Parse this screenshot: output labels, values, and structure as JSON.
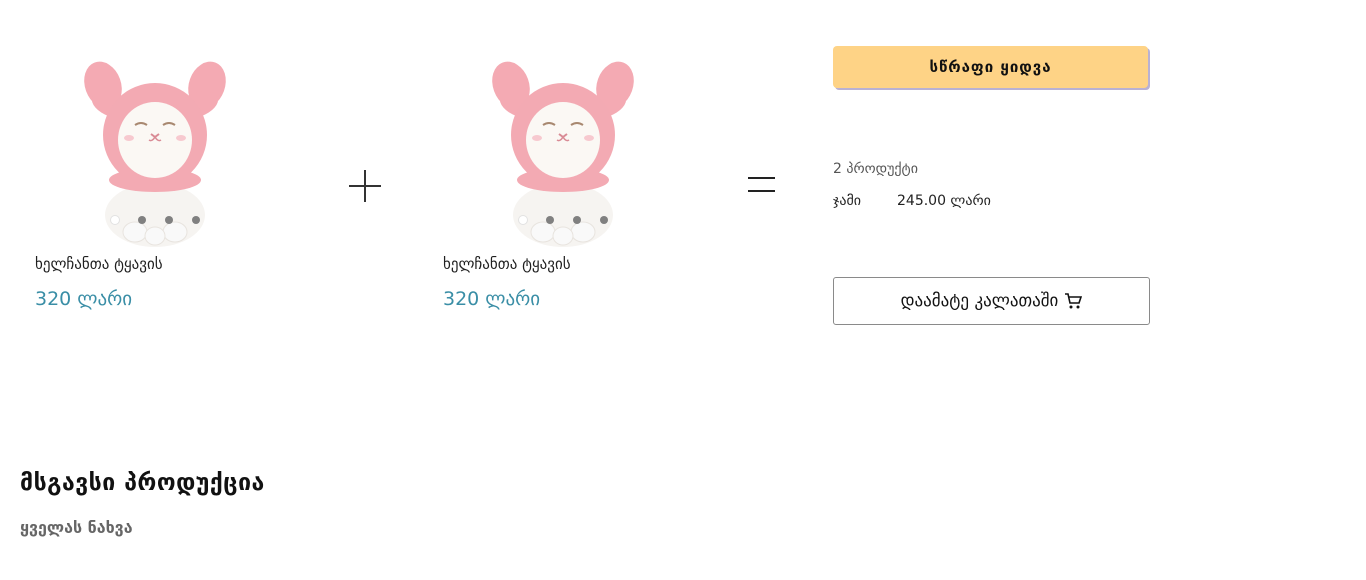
{
  "products": [
    {
      "name": "ხელჩანთა ტყავის",
      "price": "320 ლარი"
    },
    {
      "name": "ხელჩანთა ტყავის",
      "price": "320 ლარი"
    }
  ],
  "operators": {
    "plus": "+",
    "equals": "="
  },
  "bundle": {
    "quick_buy_label": "სწრაფი ყიდვა",
    "count_text": "2 პროდუქტი",
    "total_label": "ჯამი",
    "total_value": "245.00 ლარი",
    "add_to_cart_label": "დაამატე კალათაში",
    "cart_icon": "shopping-cart-icon"
  },
  "similar": {
    "title": "მსგავსი პროდუქცია",
    "see_all": "ყველას ნახვა"
  },
  "colors": {
    "price": "#3a8ea6",
    "quick_buy_bg": "#fed386",
    "plush_pink": "#f2a9b1"
  }
}
